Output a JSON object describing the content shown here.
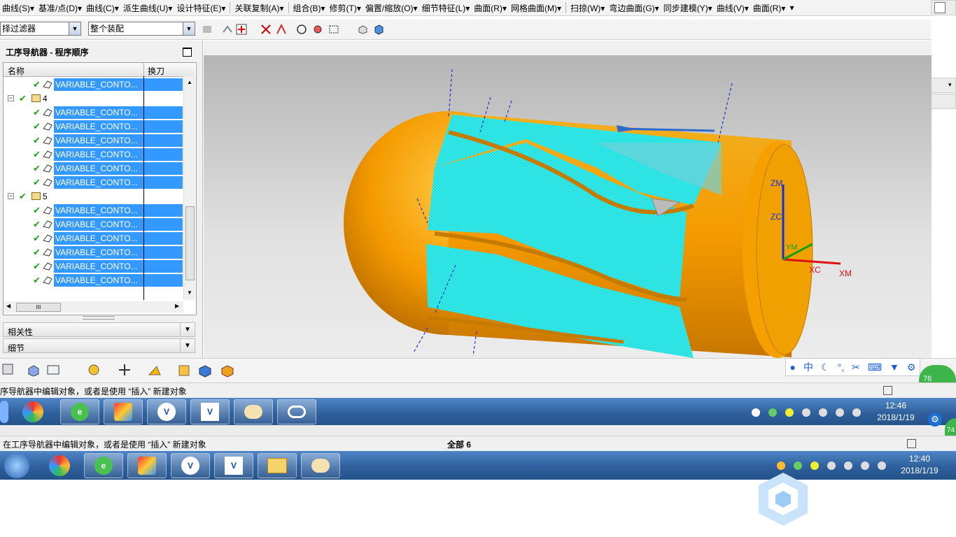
{
  "menu": [
    "曲线(S)▾",
    "基准/点(D)▾",
    "曲线(C)▾",
    "派生曲线(U)▾",
    "设计特征(E)▾",
    "|",
    "关联复制(A)▾",
    "|",
    "组合(B)▾",
    "修剪(T)▾",
    "偏置/缩放(O)▾",
    "细节特征(L)▾",
    "曲面(R)▾",
    "网格曲面(M)▾",
    "|",
    "扫掠(W)▾",
    "弯边曲面(G)▾",
    "同步建模(Y)▾",
    "曲线(V)▾",
    "曲面(R)▾",
    "▾"
  ],
  "toolbar": {
    "filter_label": "择过滤器",
    "assembly_label": "整个装配"
  },
  "navigator": {
    "title": "工序导航器 - 程序顺序",
    "col_name": "名称",
    "col_tool": "换刀",
    "rows": [
      {
        "type": "op",
        "label": "VARIABLE_CONTO..."
      },
      {
        "type": "group",
        "label": "4"
      },
      {
        "type": "op",
        "label": "VARIABLE_CONTO..."
      },
      {
        "type": "op",
        "label": "VARIABLE_CONTO..."
      },
      {
        "type": "op",
        "label": "VARIABLE_CONTO..."
      },
      {
        "type": "op",
        "label": "VARIABLE_CONTO..."
      },
      {
        "type": "op",
        "label": "VARIABLE_CONTO..."
      },
      {
        "type": "op",
        "label": "VARIABLE_CONTO..."
      },
      {
        "type": "group",
        "label": "5"
      },
      {
        "type": "op",
        "label": "VARIABLE_CONTO..."
      },
      {
        "type": "op",
        "label": "VARIABLE_CONTO..."
      },
      {
        "type": "op",
        "label": "VARIABLE_CONTO..."
      },
      {
        "type": "op",
        "label": "VARIABLE_CONTO..."
      },
      {
        "type": "op",
        "label": "VARIABLE_CONTO..."
      },
      {
        "type": "op",
        "label": "VARIABLE_CONTO..."
      }
    ],
    "hscroll_thumb": "III",
    "panel_related": "相关性",
    "panel_detail": "细节"
  },
  "viewport": {
    "axis_zm": "ZM",
    "axis_zc": "ZC",
    "axis_ym": "YM",
    "axis_xc": "XC",
    "axis_xm": "XM"
  },
  "ime": [
    "中"
  ],
  "status_top": "序导航器中编辑对象，或者是使用 “插入” 新建对象",
  "status_bottom": "在工序导航器中编辑对象，或者是使用 “插入” 新建对象",
  "status_all": "全部 6",
  "taskbar_top": {
    "time": "12:46",
    "date": "2018/1/19",
    "badge": "76"
  },
  "taskbar_bottom": {
    "time": "12:40",
    "date": "2018/1/19",
    "badge": "74"
  },
  "colors": {
    "selection": "#3399ff",
    "part": "#f5a300",
    "toolpath": "#35f0f0",
    "taskbar": "#2f5f9c"
  }
}
